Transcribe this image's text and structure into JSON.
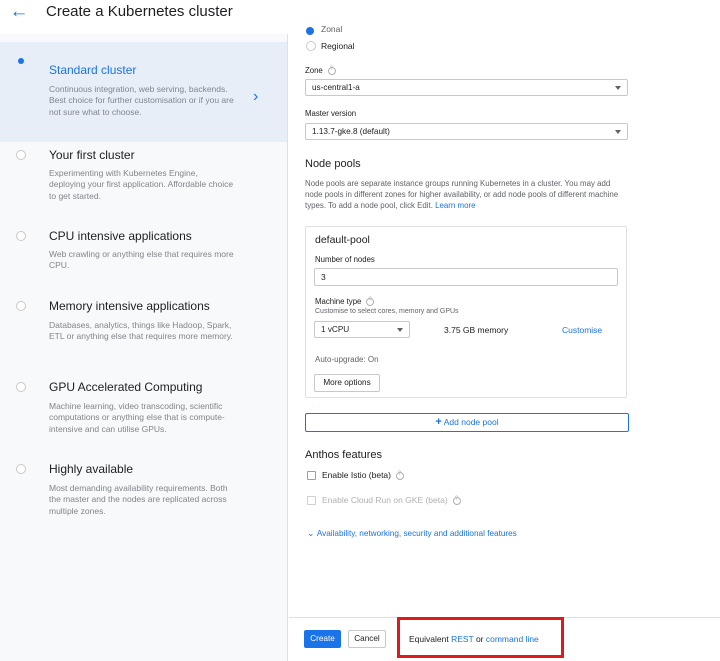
{
  "header": {
    "title": "Create a Kubernetes cluster",
    "back_icon": "arrow-back-icon"
  },
  "sidebar": {
    "items": [
      {
        "title": "Standard cluster",
        "desc": "Continuous integration, web serving, backends. Best choice for further customisation or if you are not sure what to choose."
      },
      {
        "title": "Your first cluster",
        "desc": "Experimenting with Kubernetes Engine, deploying your first application. Affordable choice to get started."
      },
      {
        "title": "CPU intensive applications",
        "desc": "Web crawling or anything else that requires more CPU."
      },
      {
        "title": "Memory intensive applications",
        "desc": "Databases, analytics, things like Hadoop, Spark, ETL or anything else that requires more memory."
      },
      {
        "title": "GPU Accelerated Computing",
        "desc": "Machine learning, video transcoding, scientific computations or anything else that is compute-intensive and can utilise GPUs."
      },
      {
        "title": "Highly available",
        "desc": "Most demanding availability requirements. Both the master and the nodes are replicated across multiple zones."
      }
    ]
  },
  "main": {
    "location_zonal": "Zonal",
    "location_regional": "Regional",
    "zone_label": "Zone",
    "zone_value": "us-central1-a",
    "master_label": "Master version",
    "master_value": "1.13.7-gke.8 (default)",
    "node_pools_heading": "Node pools",
    "node_pools_desc": "Node pools are separate instance groups running Kubernetes in a cluster. You may add node pools in different zones for higher availability, or add node pools of different machine types. To add a node pool, click Edit.",
    "learn_more": "Learn more",
    "pool": {
      "name": "default-pool",
      "nodes_label": "Number of nodes",
      "nodes_value": "3",
      "machine_label": "Machine type",
      "machine_hint": "Customise to select cores, memory and GPUs",
      "machine_value": "1 vCPU",
      "memory": "3.75 GB memory",
      "customise": "Customise",
      "autoupgrade": "Auto-upgrade: On",
      "more_options": "More options"
    },
    "add_pool": "Add node pool",
    "anthos_heading": "Anthos features",
    "istio": "Enable Istio (beta)",
    "cloudrun": "Enable Cloud Run on GKE (beta)",
    "advanced": "Availability, networking, security and additional features"
  },
  "footer": {
    "create": "Create",
    "cancel": "Cancel",
    "equiv_prefix": "Equivalent ",
    "rest": "REST",
    "or": " or ",
    "cmdline": "command line"
  }
}
